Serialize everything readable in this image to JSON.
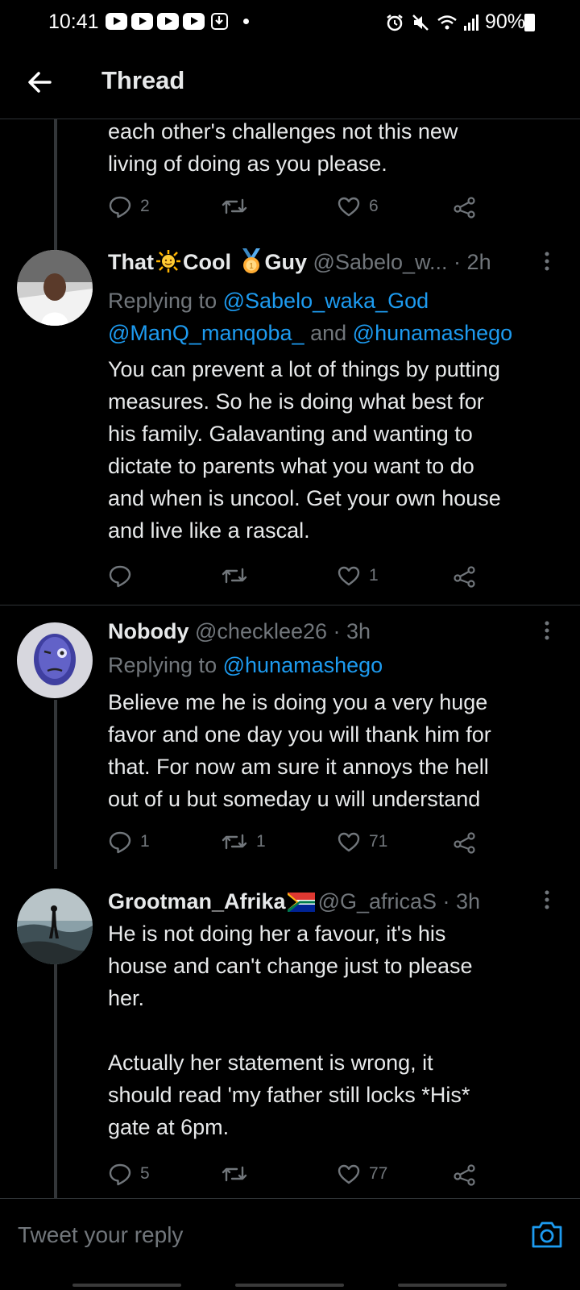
{
  "status_bar": {
    "time": "10:41",
    "battery": "90%",
    "notification_icons": [
      "youtube-icon",
      "youtube-icon",
      "youtube-icon",
      "youtube-icon",
      "download-icon",
      "dot-icon"
    ],
    "system_icons": [
      "alarm-icon",
      "mute-icon",
      "wifi-icon",
      "signal-icon",
      "battery-charging-icon"
    ]
  },
  "header": {
    "title": "Thread"
  },
  "colors": {
    "background": "#000000",
    "text": "#e7e9ea",
    "secondary": "#71767b",
    "accent": "#1d9bf0",
    "divider": "#2f3336"
  },
  "tweets": [
    {
      "text": "each other's challenges not this new\nliving of doing as you please.",
      "reply_count": "2",
      "retweet_count": "",
      "like_count": "6"
    },
    {
      "name_parts": [
        "That",
        "Cool",
        "Guy"
      ],
      "name_emojis": [
        "sun-emoji",
        "medal-emoji"
      ],
      "meta": "@Sabelo_w... · 2h",
      "replying_prefix": "Replying to",
      "mentions": [
        "@Sabelo_waka_God",
        "@ManQ_manqoba_",
        "@hunamashego"
      ],
      "mention_joiner": "and",
      "text": "You can prevent a lot of things by putting\nmeasures. So he is doing what best for\nhis family. Galavanting and wanting to\ndictate to parents what you want to do\nand when is uncool. Get your own house\nand live like a rascal.",
      "reply_count": "",
      "retweet_count": "",
      "like_count": "1"
    },
    {
      "name": "Nobody",
      "meta": "@checklee26 · 3h",
      "replying_prefix": "Replying to",
      "mentions": [
        "@hunamashego"
      ],
      "text": "Believe me he is doing you a very huge\nfavor and one day you will thank him for\nthat. For now am sure it annoys the hell\nout of u but someday u will understand",
      "reply_count": "1",
      "retweet_count": "1",
      "like_count": "71"
    },
    {
      "name": "Grootman_Afrika",
      "name_emojis": [
        "south-africa-flag-emoji"
      ],
      "meta": "@G_africaS · 3h",
      "text": "He is not doing her a favour, it's his\nhouse and can't change just to please\nher.\n\nActually her statement is wrong, it\nshould read 'my father still locks *His*\ngate at 6pm.",
      "reply_count": "5",
      "retweet_count": "",
      "like_count": "77"
    }
  ],
  "reply_box": {
    "placeholder": "Tweet your reply"
  }
}
